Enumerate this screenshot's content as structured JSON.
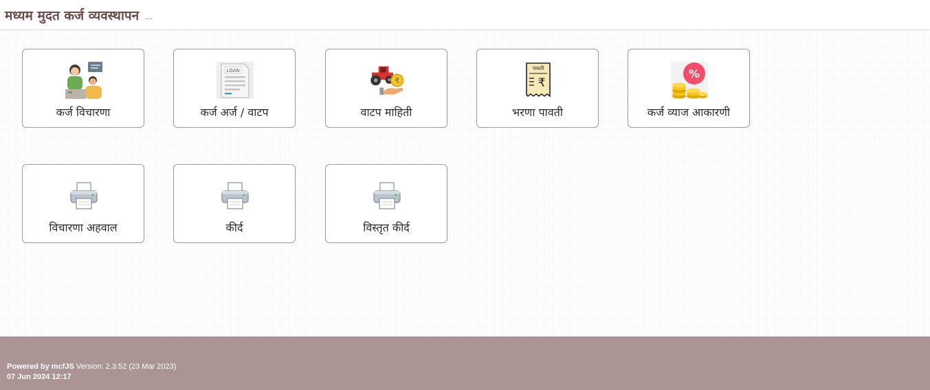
{
  "header": {
    "title": "मध्यम मुदत कर्ज व्यवस्थापन",
    "ellipsis": "..."
  },
  "tiles": [
    {
      "label": "कर्ज विचारणा",
      "icon": "loan-inquiry-icon"
    },
    {
      "label": "कर्ज अर्ज / वाटप",
      "icon": "loan-document-icon",
      "icon_text": "LOAN"
    },
    {
      "label": "वाटप माहिती",
      "icon": "tractor-coin-icon"
    },
    {
      "label": "भरणा पावती",
      "icon": "receipt-icon",
      "icon_text": "पावती"
    },
    {
      "label": "कर्ज व्याज आकारणी",
      "icon": "interest-coins-icon",
      "icon_text": "%"
    },
    {
      "label": "विचारणा अहवाल",
      "icon": "printer-icon"
    },
    {
      "label": "कीर्द",
      "icon": "printer-icon"
    },
    {
      "label": "विस्तृत कीर्द",
      "icon": "printer-icon"
    }
  ],
  "footer": {
    "powered_prefix": "Powered by ",
    "powered_brand": "mcfJS",
    "version_text": " Version: 2.3.52 (23 Mar 2023)",
    "timestamp": "07 Jun 2024 12:17"
  },
  "colors": {
    "accent_title": "#6b4a4a",
    "tile_border": "#a99393",
    "footer_bg": "#ab9594"
  }
}
